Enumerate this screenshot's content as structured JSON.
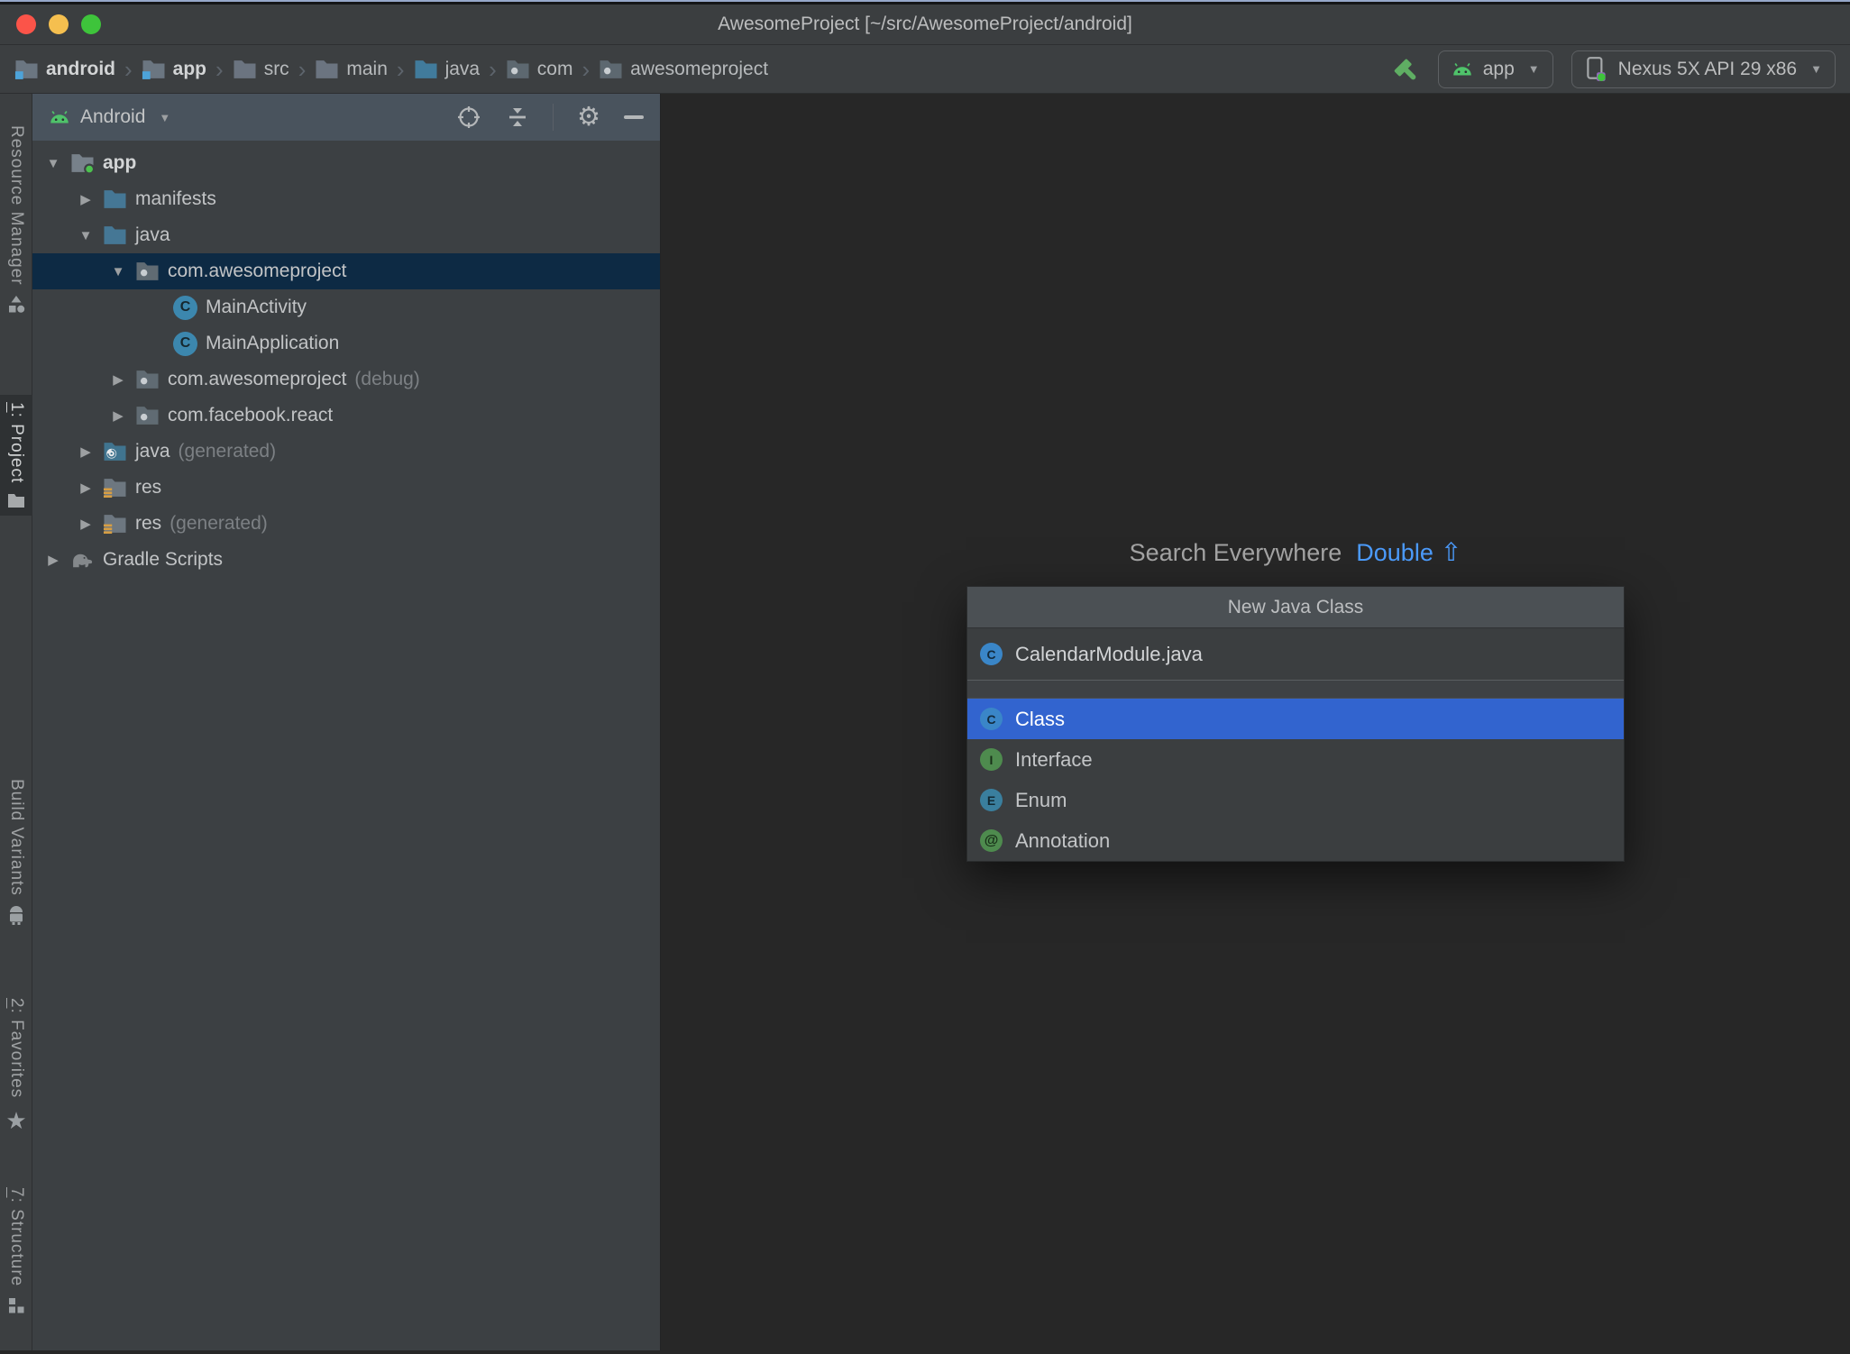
{
  "colors": {
    "selection_blue": "#3264cf",
    "selection_navy": "#0d2a44",
    "android_green": "#4fc36a",
    "link_blue": "#4b9afa",
    "panel_bg": "#3c4043",
    "editor_bg": "#272727"
  },
  "window": {
    "title": "AwesomeProject [~/src/AwesomeProject/android]"
  },
  "toolbar": {
    "breadcrumbs": [
      {
        "label": "android",
        "icon": "module-folder-icon",
        "bold": true
      },
      {
        "label": "app",
        "icon": "module-folder-icon",
        "bold": true
      },
      {
        "label": "src",
        "icon": "folder-icon",
        "bold": false
      },
      {
        "label": "main",
        "icon": "folder-icon",
        "bold": false
      },
      {
        "label": "java",
        "icon": "source-folder-icon",
        "bold": false
      },
      {
        "label": "com",
        "icon": "package-icon",
        "bold": false
      },
      {
        "label": "awesomeproject",
        "icon": "package-icon",
        "bold": false
      }
    ],
    "build": {
      "icon": "hammer-icon"
    },
    "run_config": {
      "label": "app",
      "icon": "android-icon"
    },
    "device_selector": {
      "label": "Nexus 5X API 29 x86",
      "icon": "phone-icon"
    }
  },
  "left_stripe": {
    "top": [
      {
        "mnemonic": "",
        "label": "Resource Manager",
        "icon": "shapes-icon",
        "active": false
      },
      {
        "mnemonic": "1",
        "label": ": Project",
        "icon": "project-folder-icon",
        "active": true
      }
    ],
    "bottom": [
      {
        "mnemonic": "",
        "label": "Build Variants",
        "icon": "android-robot-icon",
        "active": false
      },
      {
        "mnemonic": "2",
        "label": ": Favorites",
        "icon": "star-icon",
        "active": false
      },
      {
        "mnemonic": "7",
        "label": ": Structure",
        "icon": "structure-icon",
        "active": false
      }
    ]
  },
  "project_panel": {
    "view_selector": {
      "label": "Android",
      "icon": "android-icon"
    },
    "header_icons": [
      "locate-icon",
      "collapse-all-icon",
      "settings-gear-icon",
      "hide-icon"
    ],
    "tree": [
      {
        "label": "app",
        "suffix": "",
        "level": 0,
        "state": "expanded",
        "icon": "app-module-folder-icon",
        "selected": false,
        "bold": true
      },
      {
        "label": "manifests",
        "suffix": "",
        "level": 1,
        "state": "collapsed",
        "icon": "blue-folder-icon",
        "selected": false,
        "bold": false
      },
      {
        "label": "java",
        "suffix": "",
        "level": 1,
        "state": "expanded",
        "icon": "blue-folder-icon",
        "selected": false,
        "bold": false
      },
      {
        "label": "com.awesomeproject",
        "suffix": "",
        "level": 2,
        "state": "expanded",
        "icon": "package-icon",
        "selected": true,
        "bold": false
      },
      {
        "label": "MainActivity",
        "suffix": "",
        "level": 3,
        "state": "none",
        "icon": "class-icon",
        "badge": "C",
        "selected": false,
        "bold": false
      },
      {
        "label": "MainApplication",
        "suffix": "",
        "level": 3,
        "state": "none",
        "icon": "class-icon",
        "badge": "C",
        "selected": false,
        "bold": false
      },
      {
        "label": "com.awesomeproject",
        "suffix": "(debug)",
        "level": 2,
        "state": "collapsed",
        "icon": "package-icon",
        "selected": false,
        "bold": false
      },
      {
        "label": "com.facebook.react",
        "suffix": "",
        "level": 2,
        "state": "collapsed",
        "icon": "package-icon",
        "selected": false,
        "bold": false
      },
      {
        "label": "java",
        "suffix": "(generated)",
        "level": 1,
        "state": "collapsed",
        "icon": "generated-source-folder-icon",
        "selected": false,
        "bold": false
      },
      {
        "label": "res",
        "suffix": "",
        "level": 1,
        "state": "collapsed",
        "icon": "resource-folder-icon",
        "selected": false,
        "bold": false
      },
      {
        "label": "res",
        "suffix": "(generated)",
        "level": 1,
        "state": "collapsed",
        "icon": "resource-folder-icon",
        "selected": false,
        "bold": false
      },
      {
        "label": "Gradle Scripts",
        "suffix": "",
        "level": 0,
        "state": "collapsed",
        "icon": "gradle-elephant-icon",
        "selected": false,
        "bold": false
      }
    ]
  },
  "editor": {
    "hint": {
      "text": "Search Everywhere",
      "shortcut_label": "Double",
      "shortcut_key": "⇧"
    }
  },
  "dialog": {
    "title": "New Java Class",
    "file_name": "CalendarModule.java",
    "file_icon": "class-icon",
    "file_badge": "C",
    "items": [
      {
        "label": "Class",
        "icon": "class-icon",
        "badge": "C",
        "selected": true
      },
      {
        "label": "Interface",
        "icon": "interface-icon",
        "badge": "I",
        "selected": false
      },
      {
        "label": "Enum",
        "icon": "enum-icon",
        "badge": "E",
        "selected": false
      },
      {
        "label": "Annotation",
        "icon": "annotation-icon",
        "badge": "@",
        "selected": false
      }
    ]
  },
  "icons": {
    "breadcrumb_separator": "›",
    "dropdown_caret": "▼",
    "chevron_collapsed": "▶",
    "chevron_expanded": "▼",
    "gear": "⚙",
    "star": "★"
  }
}
